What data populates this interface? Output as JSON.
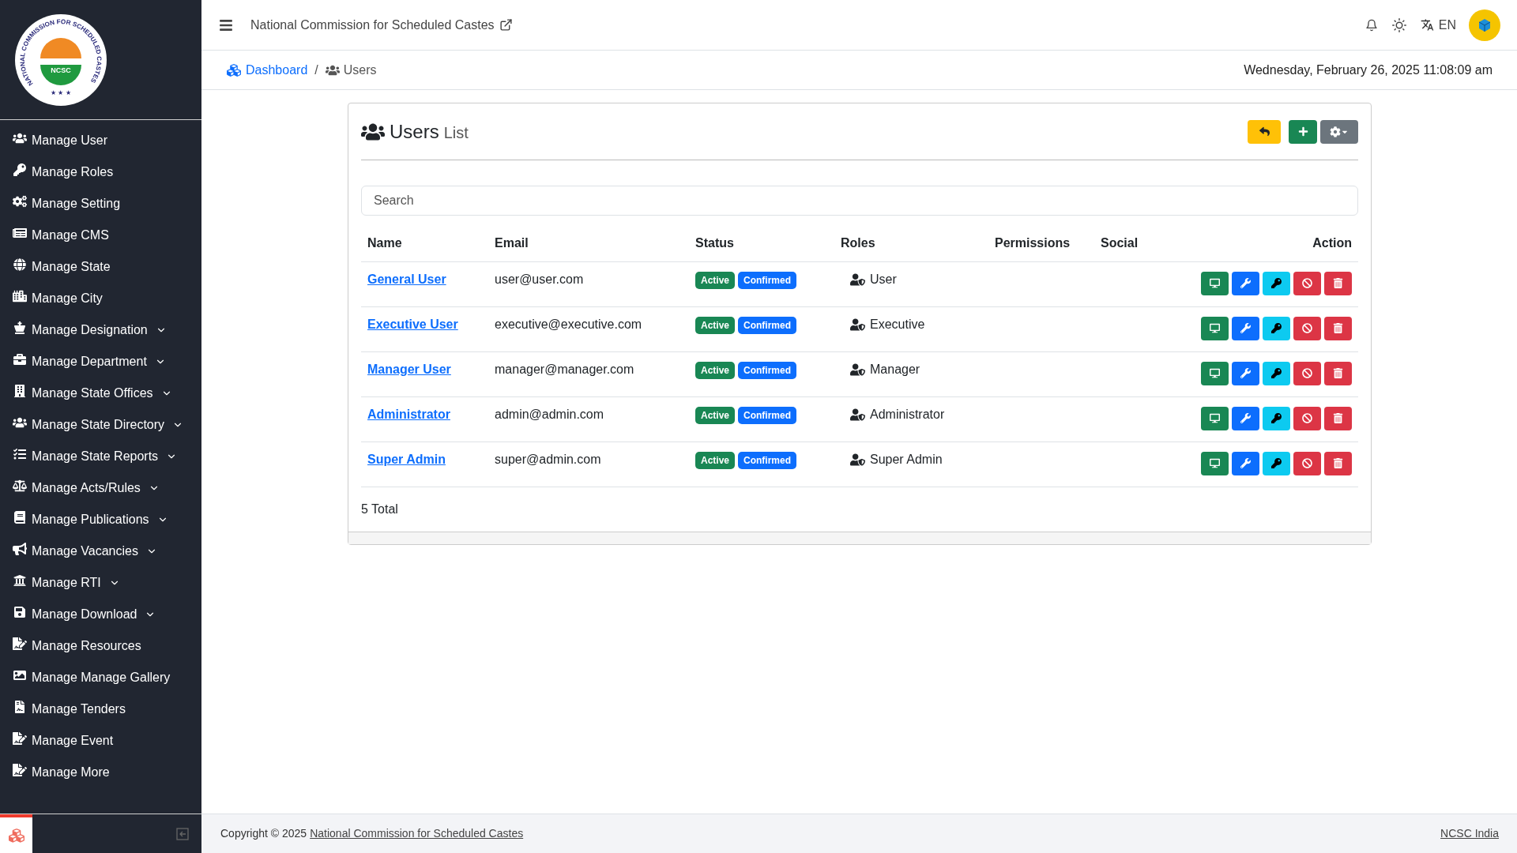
{
  "logo": {
    "ring_text": "NATIONAL COMMISSION FOR SCHEDULED CASTES",
    "center_text": "NCSC",
    "stars": "★ ★ ★"
  },
  "sidebar": {
    "items": [
      {
        "label": "Manage User",
        "expandable": false
      },
      {
        "label": "Manage Roles",
        "expandable": false
      },
      {
        "label": "Manage Setting",
        "expandable": false
      },
      {
        "label": "Manage CMS",
        "expandable": false
      },
      {
        "label": "Manage State",
        "expandable": false
      },
      {
        "label": "Manage City",
        "expandable": false
      },
      {
        "label": "Manage Designation",
        "expandable": true
      },
      {
        "label": "Manage Department",
        "expandable": true
      },
      {
        "label": "Manage State Offices",
        "expandable": true
      },
      {
        "label": "Manage State Directory",
        "expandable": true
      },
      {
        "label": "Manage State Reports",
        "expandable": true
      },
      {
        "label": "Manage Acts/Rules",
        "expandable": true
      },
      {
        "label": "Manage Publications",
        "expandable": true
      },
      {
        "label": "Manage Vacancies",
        "expandable": true
      },
      {
        "label": "Manage RTI",
        "expandable": true
      },
      {
        "label": "Manage Download",
        "expandable": true
      },
      {
        "label": "Manage Resources",
        "expandable": false
      },
      {
        "label": "Manage Manage Gallery",
        "expandable": false
      },
      {
        "label": "Manage Tenders",
        "expandable": false
      },
      {
        "label": "Manage Event",
        "expandable": false
      },
      {
        "label": "Manage More",
        "expandable": false
      }
    ]
  },
  "header": {
    "title": "National Commission for Scheduled Castes",
    "language": "EN"
  },
  "breadcrumb": {
    "items": [
      "Dashboard",
      "Users"
    ],
    "separator": "/",
    "datetime": "Wednesday, February 26, 2025 11:08:09 am"
  },
  "card": {
    "title": "Users",
    "subtitle": "List"
  },
  "search": {
    "placeholder": "Search"
  },
  "table": {
    "columns": [
      "Name",
      "Email",
      "Status",
      "Roles",
      "Permissions",
      "Social",
      "Action"
    ],
    "rows": [
      {
        "name": "General User",
        "email": "user@user.com",
        "badges": [
          {
            "label": "Active",
            "color": "#198754"
          },
          {
            "label": "Confirmed",
            "color": "#0d6efd"
          }
        ],
        "role": "User"
      },
      {
        "name": "Executive User",
        "email": "executive@executive.com",
        "badges": [
          {
            "label": "Active",
            "color": "#198754"
          },
          {
            "label": "Confirmed",
            "color": "#0d6efd"
          }
        ],
        "role": "Executive"
      },
      {
        "name": "Manager User",
        "email": "manager@manager.com",
        "badges": [
          {
            "label": "Active",
            "color": "#198754"
          },
          {
            "label": "Confirmed",
            "color": "#0d6efd"
          }
        ],
        "role": "Manager"
      },
      {
        "name": "Administrator",
        "email": "admin@admin.com",
        "badges": [
          {
            "label": "Active",
            "color": "#198754"
          },
          {
            "label": "Confirmed",
            "color": "#0d6efd"
          }
        ],
        "role": "Administrator"
      },
      {
        "name": "Super Admin",
        "email": "super@admin.com",
        "badges": [
          {
            "label": "Active",
            "color": "#198754"
          },
          {
            "label": "Confirmed",
            "color": "#0d6efd"
          }
        ],
        "role": "Super Admin"
      }
    ]
  },
  "total": "5 Total",
  "footer": {
    "copyright": "Copyright © 2025",
    "link": "National Commission for Scheduled Castes",
    "right_link": "NCSC India"
  }
}
